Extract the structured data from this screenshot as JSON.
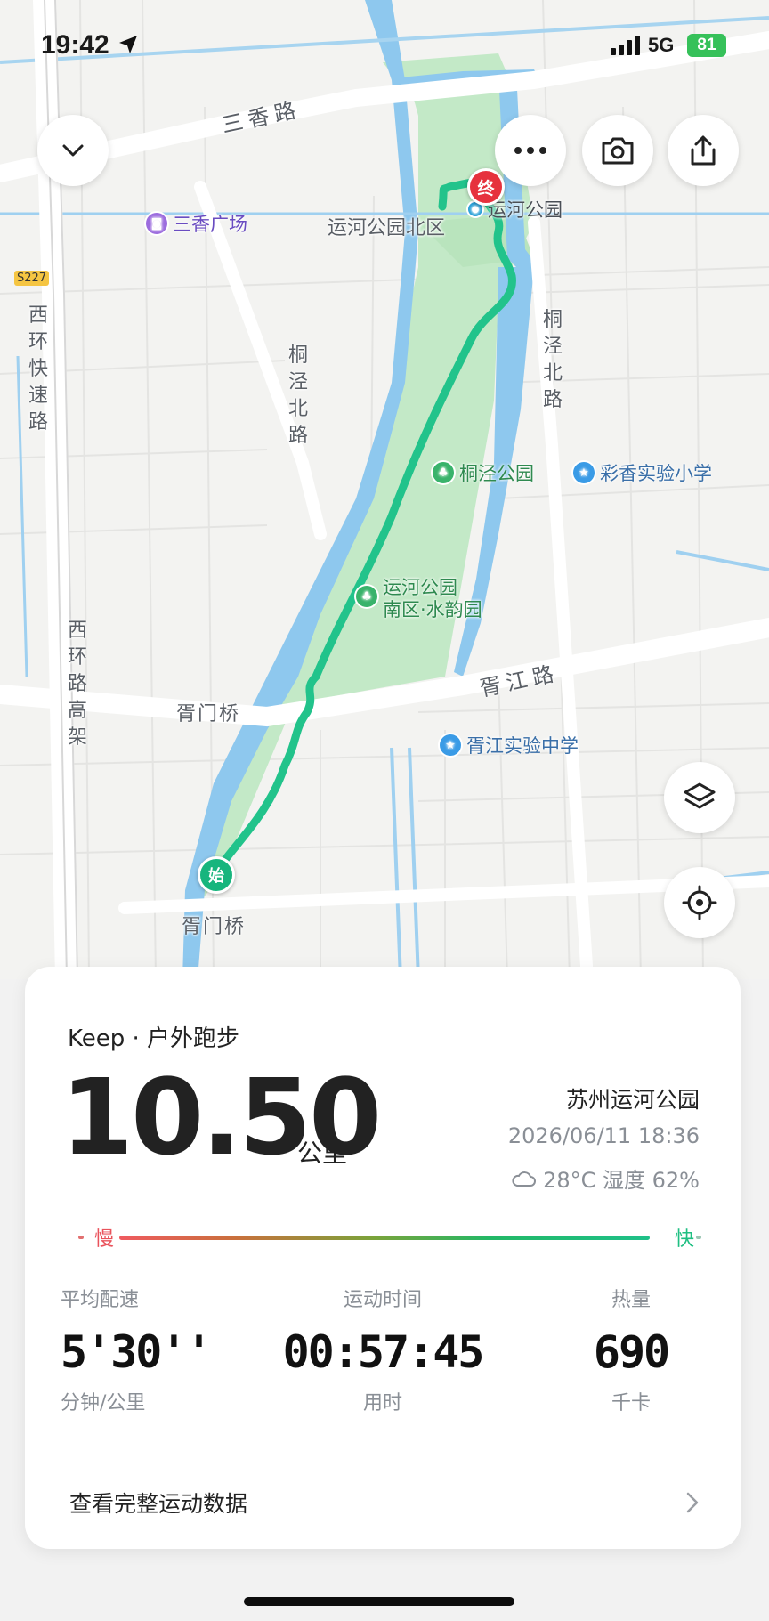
{
  "status_bar": {
    "time": "19:42",
    "network": "5G",
    "battery": "81"
  },
  "map": {
    "roads": {
      "sanxiang_rd": "三香路",
      "tongjing_n_rd_left": "桐泾北路",
      "tongjing_n_rd_right": "桐泾北路",
      "xihuan_expressway": "西环快速路",
      "xihuan_elevated": "西环路高架",
      "xujiang_rd": "胥江路",
      "xumen_bridge_upper": "胥门桥",
      "xumen_bridge_lower": "胥门桥",
      "s227": "S227"
    },
    "pois": {
      "sanxiang_plaza": "三香广场",
      "yunhe_park_north": "运河公园北区",
      "yunhe_park": "运河公园",
      "tongjing_park": "桐泾公园",
      "caixiang_school": "彩香实验小学",
      "yunhe_south_1": "运河公园",
      "yunhe_south_2": "南区·水韵园",
      "xujiang_school": "胥江实验中学"
    },
    "markers": {
      "end": "终",
      "start": "始"
    },
    "colors": {
      "route": "#22c38b",
      "water": "#8ec8ee",
      "park": "#bfe8c4",
      "end_marker": "#e6313d",
      "start_marker": "#17b57d"
    }
  },
  "toolbar": {
    "collapse_icon": "chevron-down-icon",
    "more_icon": "more-icon",
    "camera_icon": "camera-icon",
    "share_icon": "share-icon",
    "layers_icon": "layers-icon",
    "locate_icon": "locate-icon"
  },
  "summary": {
    "source": "Keep · 户外跑步",
    "distance": "10.50",
    "distance_unit": "公里",
    "location": "苏州运河公园",
    "datetime": "2026/06/11 18:36",
    "weather": "28°C  湿度 62%",
    "pace_slow": "慢",
    "pace_fast": "快",
    "stats": [
      {
        "label": "平均配速",
        "value": "5'30''",
        "sub": "分钟/公里"
      },
      {
        "label": "运动时间",
        "value": "00:57:45",
        "sub": "用时"
      },
      {
        "label": "热量",
        "value": "690",
        "sub": "千卡"
      }
    ],
    "more_link": "查看完整运动数据"
  }
}
